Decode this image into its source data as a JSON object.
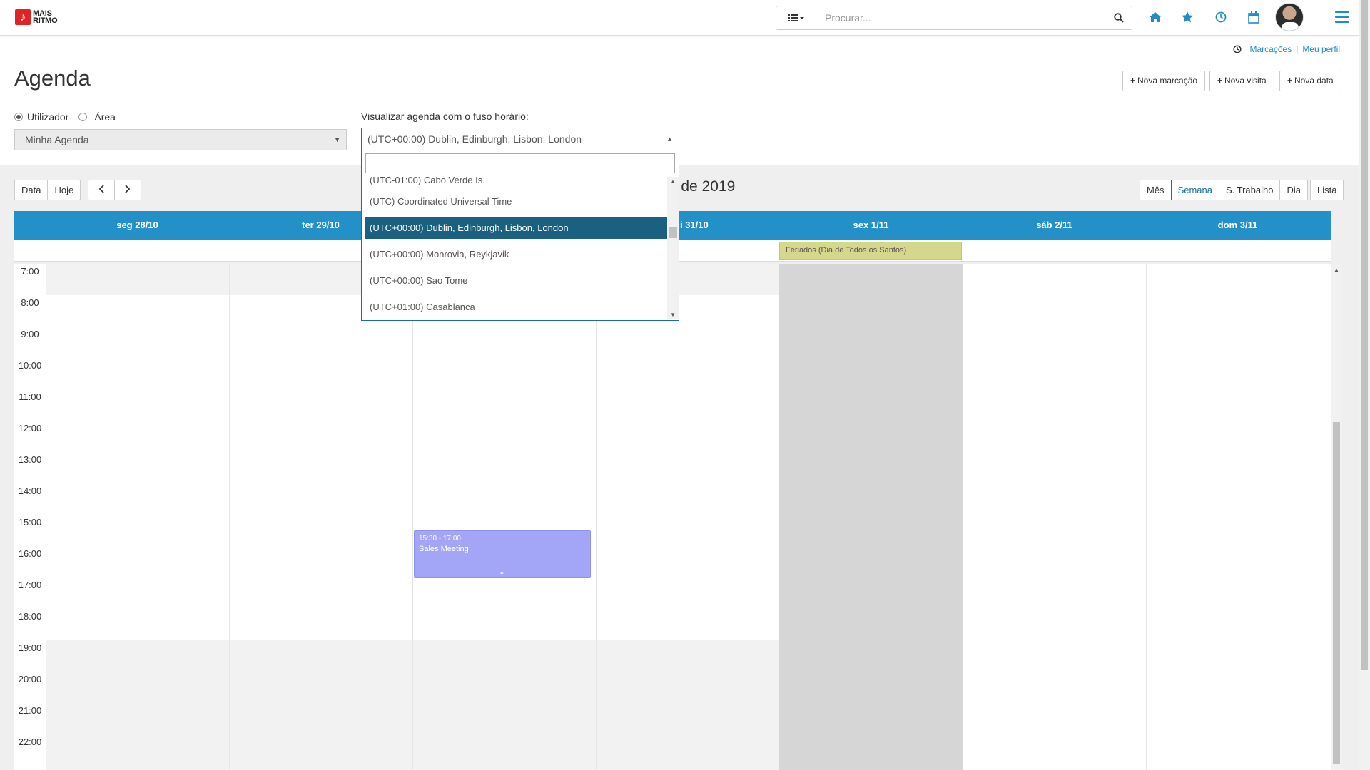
{
  "brand": {
    "line1": "MAIS",
    "line2": "RITMO"
  },
  "header": {
    "search_placeholder": "Procurar...",
    "nav_icons": [
      "home-icon",
      "star-icon",
      "clock-icon",
      "calendar-icon"
    ],
    "accent": "#1e8dc8"
  },
  "top_links": {
    "bookings": "Marcações",
    "separator": "|",
    "profile": "Meu perfil"
  },
  "page": {
    "title": "Agenda",
    "actions": [
      "Nova marcação",
      "Nova visita",
      "Nova data"
    ]
  },
  "filters": {
    "radio_user": "Utilizador",
    "radio_area": "Área",
    "agenda_select": "Minha Agenda",
    "tz_label": "Visualizar agenda com o fuso horário:",
    "tz_selected": "(UTC+00:00) Dublin, Edinburgh, Lisbon, London",
    "tz_options": [
      "(UTC-01:00) Cabo Verde Is.",
      "(UTC) Coordinated Universal Time",
      "(UTC+00:00) Dublin, Edinburgh, Lisbon, London",
      "(UTC+00:00) Monrovia, Reykjavik",
      "(UTC+00:00) Sao Tome",
      "(UTC+01:00) Casablanca"
    ],
    "tz_highlight_color": "#1a6080"
  },
  "toolbar": {
    "date_btn": "Data",
    "today_btn": "Hoje",
    "prev_icon": "chevron-left-icon",
    "next_icon": "chevron-right-icon",
    "week_title_visible": "v de 2019",
    "views": [
      "Mês",
      "Semana",
      "S. Trabalho",
      "Dia"
    ],
    "active_view": "Semana",
    "list_btn": "Lista"
  },
  "calendar": {
    "days": [
      "seg 28/10",
      "ter 29/10",
      "",
      "ui 31/10",
      "sex 1/11",
      "sáb 2/11",
      "dom 3/11"
    ],
    "header_color": "#2391c8",
    "hours": [
      "7:00",
      "8:00",
      "9:00",
      "10:00",
      "11:00",
      "12:00",
      "13:00",
      "14:00",
      "15:00",
      "16:00",
      "17:00",
      "18:00",
      "19:00",
      "20:00",
      "21:00",
      "22:00"
    ],
    "holiday": {
      "label": "Feriados (Dia de Todos os Santos)",
      "color": "#d4d78c"
    },
    "event": {
      "time": "15:30 - 17:00",
      "title": "Sales Meeting",
      "color": "#a3a6f7"
    }
  }
}
